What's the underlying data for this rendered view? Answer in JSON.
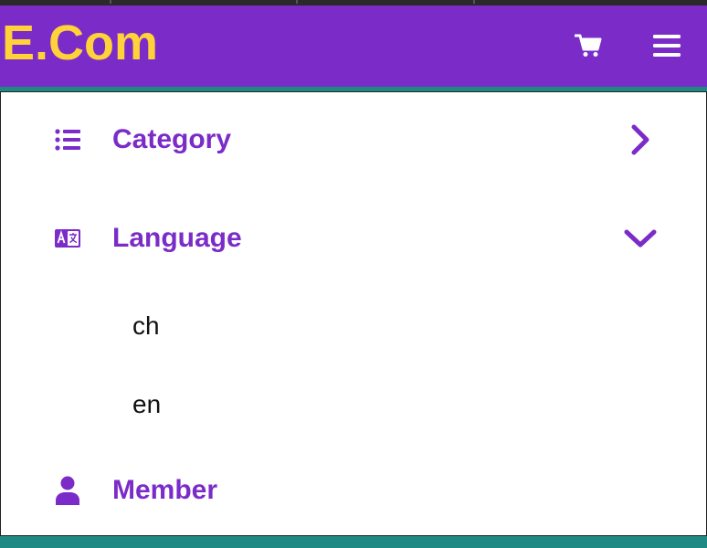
{
  "header": {
    "brand": "E.Com",
    "cart_icon": "shopping-cart-icon",
    "menu_icon": "hamburger-menu-icon"
  },
  "menu": {
    "category": {
      "label": "Category",
      "icon": "list-icon",
      "state": "collapsed"
    },
    "language": {
      "label": "Language",
      "icon": "language-translate-icon",
      "state": "expanded",
      "options": [
        "ch",
        "en"
      ]
    },
    "member": {
      "label": "Member",
      "icon": "user-icon"
    }
  },
  "colors": {
    "primary": "#7b2cc8",
    "brand_text": "#ffd23a",
    "accent": "#1f8a84"
  }
}
